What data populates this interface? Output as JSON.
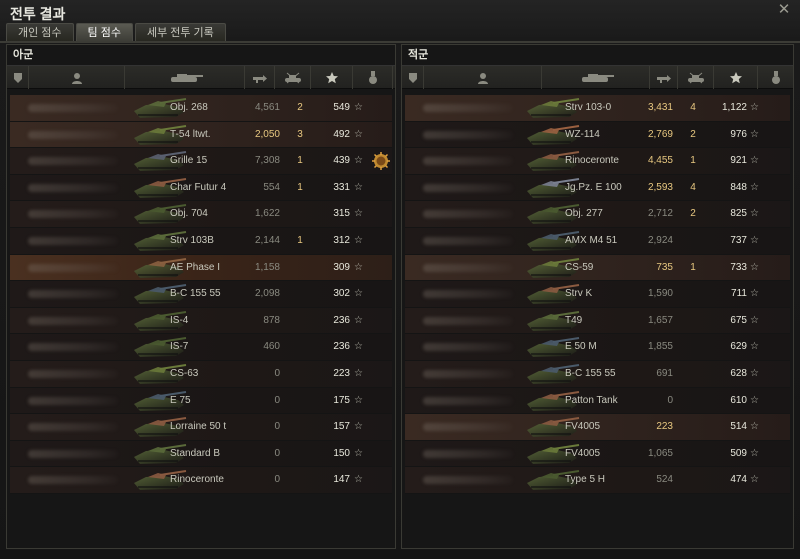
{
  "window": {
    "title": "전투 결과",
    "close_glyph": "✕"
  },
  "tabs": [
    {
      "label": "개인 점수",
      "active": false
    },
    {
      "label": "팀 점수",
      "active": true
    },
    {
      "label": "세부 전투 기록",
      "active": false
    }
  ],
  "colors": {
    "damage_highlight": "#e8c880",
    "accent_row": "#4a3020"
  },
  "icons": {
    "column_headers": [
      "platoon-icon",
      "player-icon",
      "tank-icon",
      "damage-icon",
      "kills-icon",
      "xp-star-icon",
      "medal-icon"
    ]
  },
  "allies": {
    "title": "아군",
    "rows": [
      {
        "tank": "Obj. 268",
        "damage": "4,561",
        "kills": "2",
        "xp": "549",
        "star": "☆",
        "tint": "#5a6a3a",
        "hl": true
      },
      {
        "tank": "T-54 ltwt.",
        "damage": "2,050",
        "kills": "3",
        "xp": "492",
        "star": "☆",
        "tint": "#6a7a3a",
        "hl": true,
        "bright_damage": true
      },
      {
        "tank": "Grille 15",
        "damage": "7,308",
        "kills": "1",
        "xp": "439",
        "star": "☆",
        "tint": "#5a6070",
        "medal": true
      },
      {
        "tank": "Char Futur 4",
        "damage": "554",
        "kills": "1",
        "xp": "331",
        "star": "☆",
        "tint": "#8a5a40"
      },
      {
        "tank": "Obj. 704",
        "damage": "1,622",
        "kills": "",
        "xp": "315",
        "star": "☆",
        "tint": "#4a5a30"
      },
      {
        "tank": "Strv 103B",
        "damage": "2,144",
        "kills": "1",
        "xp": "312",
        "star": "☆",
        "tint": "#5a6a3a"
      },
      {
        "tank": "AE Phase I",
        "damage": "1,158",
        "kills": "",
        "xp": "309",
        "star": "☆",
        "tint": "#8a6040",
        "me": true
      },
      {
        "tank": "B-C 155 55",
        "damage": "2,098",
        "kills": "",
        "xp": "302",
        "star": "☆",
        "tint": "#4a5a6a"
      },
      {
        "tank": "IS-4",
        "damage": "878",
        "kills": "",
        "xp": "236",
        "star": "☆",
        "tint": "#4a5a30"
      },
      {
        "tank": "IS-7",
        "damage": "460",
        "kills": "",
        "xp": "236",
        "star": "☆",
        "tint": "#4a5a30"
      },
      {
        "tank": "CS-63",
        "damage": "0",
        "kills": "",
        "xp": "223",
        "star": "☆",
        "tint": "#6a7a3a"
      },
      {
        "tank": "E 75",
        "damage": "0",
        "kills": "",
        "xp": "175",
        "star": "☆",
        "tint": "#4a5a6a"
      },
      {
        "tank": "Lorraine 50 t",
        "damage": "0",
        "kills": "",
        "xp": "157",
        "star": "☆",
        "tint": "#8a5a40"
      },
      {
        "tank": "Standard B",
        "damage": "0",
        "kills": "",
        "xp": "150",
        "star": "☆",
        "tint": "#5a6a3a"
      },
      {
        "tank": "Rinoceronte",
        "damage": "0",
        "kills": "",
        "xp": "147",
        "star": "☆",
        "tint": "#8a5a40"
      }
    ]
  },
  "enemies": {
    "title": "적군",
    "rows": [
      {
        "tank": "Strv 103-0",
        "damage": "3,431",
        "kills": "4",
        "xp": "1,122",
        "star": "☆",
        "tint": "#6a7a3a",
        "bright_damage": true,
        "hl": true
      },
      {
        "tank": "WZ-114",
        "damage": "2,769",
        "kills": "2",
        "xp": "976",
        "star": "☆",
        "tint": "#9a6040",
        "bright_damage": true
      },
      {
        "tank": "Rinoceronte",
        "damage": "4,455",
        "kills": "1",
        "xp": "921",
        "star": "☆",
        "tint": "#8a5a40",
        "bright_damage": true
      },
      {
        "tank": "Jg.Pz. E 100",
        "damage": "2,593",
        "kills": "4",
        "xp": "848",
        "star": "☆",
        "tint": "#7a8090",
        "bright_damage": true
      },
      {
        "tank": "Obj. 277",
        "damage": "2,712",
        "kills": "2",
        "xp": "825",
        "star": "☆",
        "tint": "#4a5a30"
      },
      {
        "tank": "AMX M4 51",
        "damage": "2,924",
        "kills": "",
        "xp": "737",
        "star": "☆",
        "tint": "#4a5a6a"
      },
      {
        "tank": "CS-59",
        "damage": "735",
        "kills": "1",
        "xp": "733",
        "star": "☆",
        "tint": "#6a7a3a",
        "bright_damage": true,
        "hl": true
      },
      {
        "tank": "Strv K",
        "damage": "1,590",
        "kills": "",
        "xp": "711",
        "star": "☆",
        "tint": "#8a5a40"
      },
      {
        "tank": "T49",
        "damage": "1,657",
        "kills": "",
        "xp": "675",
        "star": "☆",
        "tint": "#5a6a3a"
      },
      {
        "tank": "E 50 M",
        "damage": "1,855",
        "kills": "",
        "xp": "629",
        "star": "☆",
        "tint": "#4a5a6a"
      },
      {
        "tank": "B-C 155 55",
        "damage": "691",
        "kills": "",
        "xp": "628",
        "star": "☆",
        "tint": "#4a5a6a"
      },
      {
        "tank": "Patton Tank",
        "damage": "0",
        "kills": "",
        "xp": "610",
        "star": "☆",
        "tint": "#8a5a40"
      },
      {
        "tank": "FV4005",
        "damage": "223",
        "kills": "",
        "xp": "514",
        "star": "☆",
        "tint": "#8a5a40",
        "bright_damage": true,
        "hl": true
      },
      {
        "tank": "FV4005",
        "damage": "1,065",
        "kills": "",
        "xp": "509",
        "star": "☆",
        "tint": "#6a7a3a"
      },
      {
        "tank": "Type 5 H",
        "damage": "524",
        "kills": "",
        "xp": "474",
        "star": "☆",
        "tint": "#4a5a30"
      }
    ]
  }
}
